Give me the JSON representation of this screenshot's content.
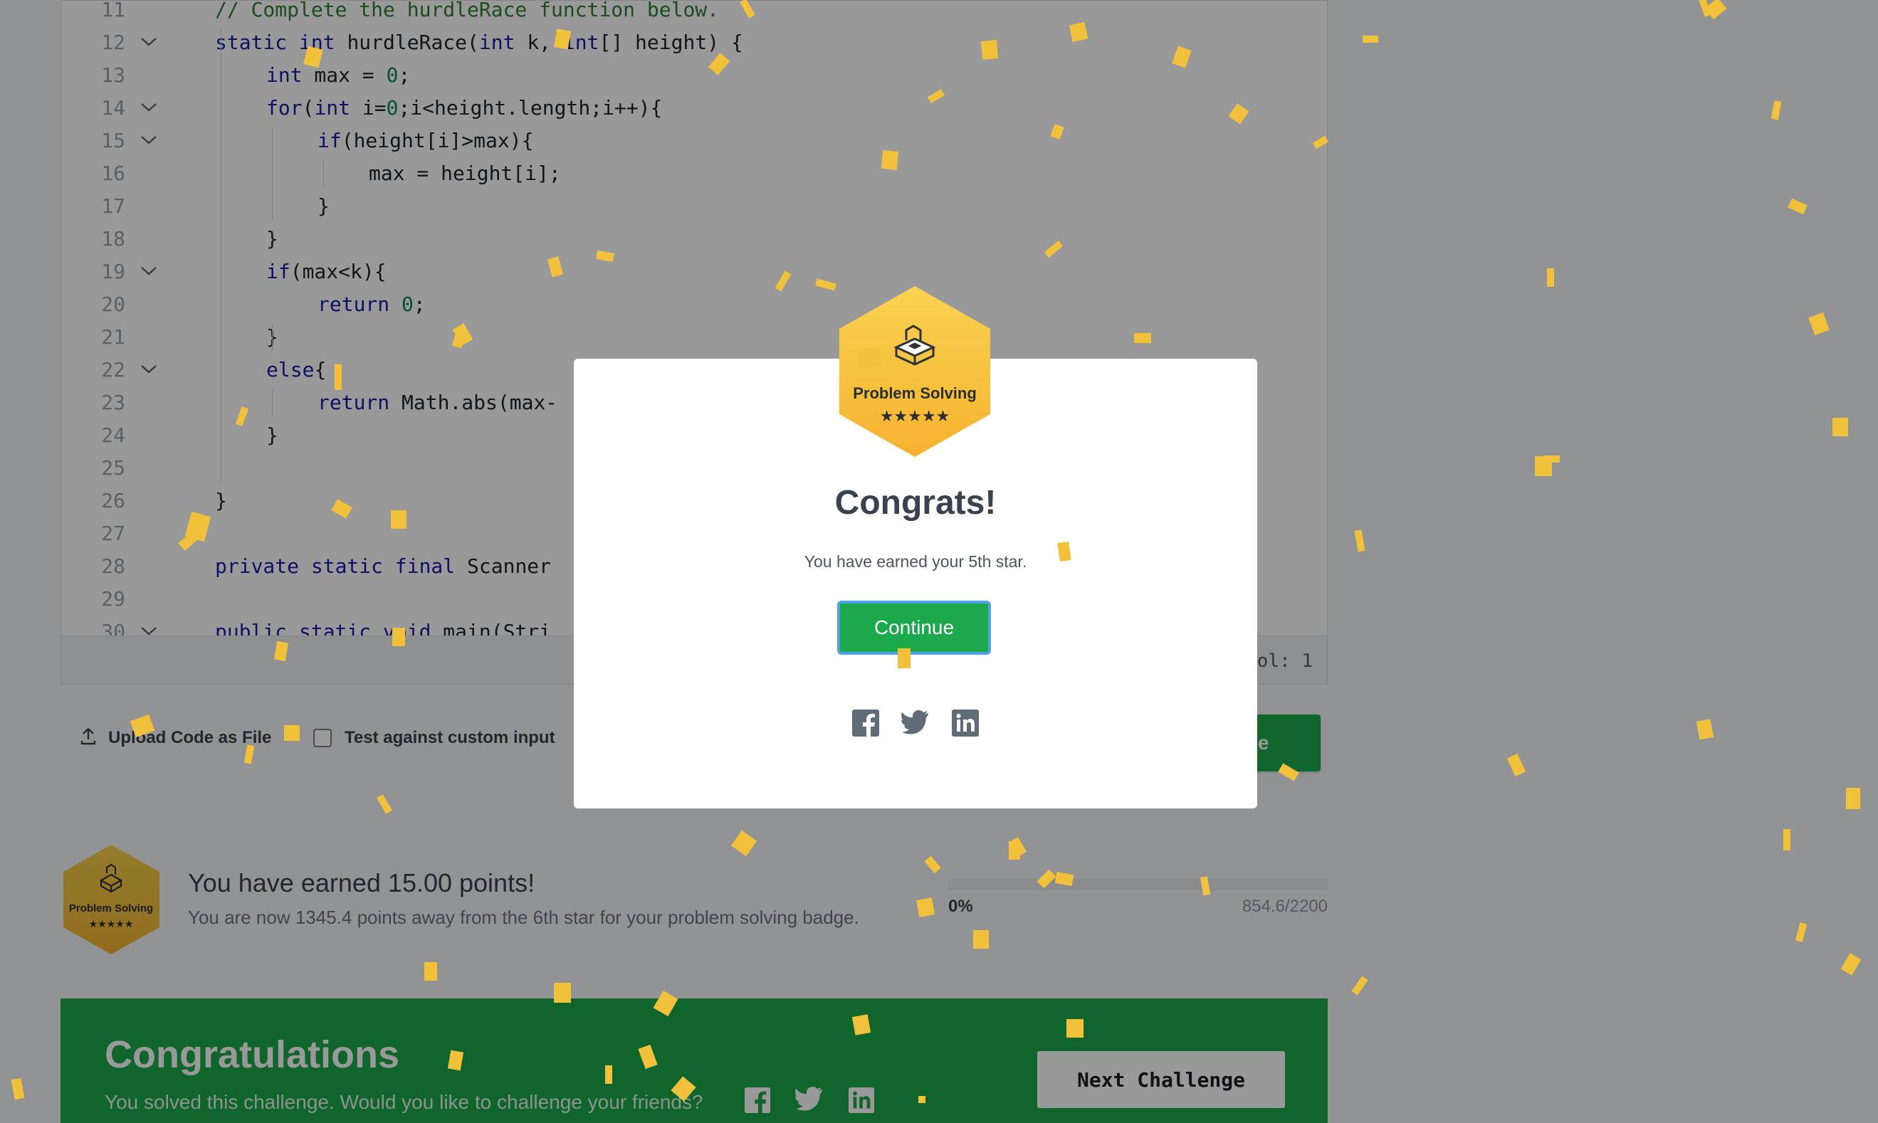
{
  "editor": {
    "lines": [
      {
        "n": "11",
        "fold": false,
        "indent": 0,
        "parts": [
          [
            "cm",
            "// Complete the hurdleRace function below."
          ]
        ]
      },
      {
        "n": "12",
        "fold": true,
        "indent": 0,
        "parts": [
          [
            "kw",
            "static "
          ],
          [
            "kw",
            "int"
          ],
          [
            "t",
            " hurdleRace("
          ],
          [
            "kw",
            "int"
          ],
          [
            "t",
            " k, "
          ],
          [
            "kw",
            "int"
          ],
          [
            "t",
            "[] height) {"
          ]
        ]
      },
      {
        "n": "13",
        "fold": false,
        "indent": 1,
        "parts": [
          [
            "kw",
            "int"
          ],
          [
            "t",
            " max = "
          ],
          [
            "num",
            "0"
          ],
          [
            "t",
            ";"
          ]
        ]
      },
      {
        "n": "14",
        "fold": true,
        "indent": 1,
        "parts": [
          [
            "kw",
            "for"
          ],
          [
            "t",
            "("
          ],
          [
            "kw",
            "int"
          ],
          [
            "t",
            " i="
          ],
          [
            "num",
            "0"
          ],
          [
            "t",
            ";i<height.length;i++){"
          ]
        ]
      },
      {
        "n": "15",
        "fold": true,
        "indent": 2,
        "parts": [
          [
            "kw",
            "if"
          ],
          [
            "t",
            "(height[i]>max){"
          ]
        ]
      },
      {
        "n": "16",
        "fold": false,
        "indent": 3,
        "parts": [
          [
            "t",
            "max = height[i];"
          ]
        ]
      },
      {
        "n": "17",
        "fold": false,
        "indent": 2,
        "parts": [
          [
            "t",
            "}"
          ]
        ]
      },
      {
        "n": "18",
        "fold": false,
        "indent": 1,
        "parts": [
          [
            "t",
            "}"
          ]
        ]
      },
      {
        "n": "19",
        "fold": true,
        "indent": 1,
        "parts": [
          [
            "kw",
            "if"
          ],
          [
            "t",
            "(max<k){"
          ]
        ]
      },
      {
        "n": "20",
        "fold": false,
        "indent": 2,
        "parts": [
          [
            "kw",
            "return "
          ],
          [
            "num",
            "0"
          ],
          [
            "t",
            ";"
          ]
        ]
      },
      {
        "n": "21",
        "fold": false,
        "indent": 1,
        "parts": [
          [
            "t",
            "}"
          ]
        ]
      },
      {
        "n": "22",
        "fold": true,
        "indent": 1,
        "parts": [
          [
            "kw",
            "else"
          ],
          [
            "t",
            "{"
          ]
        ]
      },
      {
        "n": "23",
        "fold": false,
        "indent": 2,
        "parts": [
          [
            "kw",
            "return"
          ],
          [
            "t",
            " Math.abs(max-"
          ]
        ]
      },
      {
        "n": "24",
        "fold": false,
        "indent": 1,
        "parts": [
          [
            "t",
            "}"
          ]
        ]
      },
      {
        "n": "25",
        "fold": false,
        "indent": 0,
        "parts": []
      },
      {
        "n": "26",
        "fold": false,
        "indent": 0,
        "parts": [
          [
            "t",
            "}"
          ]
        ]
      },
      {
        "n": "27",
        "fold": false,
        "indent": 0,
        "parts": []
      },
      {
        "n": "28",
        "fold": false,
        "indent": 0,
        "parts": [
          [
            "kw",
            "private static final"
          ],
          [
            "t",
            " Scanner"
          ]
        ]
      },
      {
        "n": "29",
        "fold": false,
        "indent": 0,
        "parts": []
      },
      {
        "n": "30",
        "fold": true,
        "indent": 0,
        "parts": [
          [
            "kw",
            "public static void"
          ],
          [
            "t",
            " main(Stri"
          ]
        ]
      }
    ],
    "status_col": "ol: 1"
  },
  "actions": {
    "upload_label": "Upload Code as File",
    "custom_input_label": "Test against custom input",
    "submit_label": "ode"
  },
  "points": {
    "badge_title": "Problem Solving",
    "badge_stars": "★★★★★",
    "title": "You have earned 15.00 points!",
    "subtitle": "You are now 1345.4 points away from the 6th star for your problem solving badge.",
    "progress_label": "0%",
    "progress_count": "854.6/2200",
    "progress_fraction": 0.0
  },
  "banner": {
    "title": "Congratulations",
    "subtitle": "You solved this challenge. Would you like to challenge your friends?",
    "next_label": "Next Challenge"
  },
  "modal": {
    "badge_title": "Problem Solving",
    "badge_stars": "★★★★★",
    "title": "Congrats!",
    "message": "You have earned your 5th star.",
    "continue_label": "Continue"
  },
  "icons": {
    "upload": "upload-icon",
    "facebook": "facebook-icon",
    "twitter": "twitter-icon",
    "linkedin": "linkedin-icon",
    "chevron": "chevron-down-icon",
    "badge": "problem-solving-badge-icon"
  },
  "colors": {
    "brand_green": "#1ba94c",
    "badge_gold": "#f5c243",
    "continue_focus": "#4fa1ec",
    "confetti": "#f2c13b"
  }
}
